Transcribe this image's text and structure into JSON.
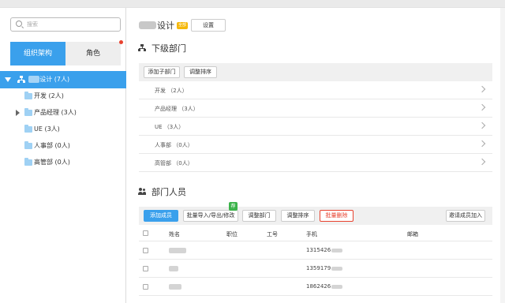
{
  "sidebar": {
    "search_placeholder": "搜索",
    "tabs": [
      {
        "label": "组织架构",
        "active": true
      },
      {
        "label": "角色",
        "active": false
      }
    ],
    "root": {
      "name_suffix": "设计 (7人)"
    },
    "items": [
      {
        "label": "开发 (2人)",
        "has_children": false
      },
      {
        "label": "产品经理 (3人)",
        "has_children": true
      },
      {
        "label": "UE (3人)",
        "has_children": false
      },
      {
        "label": "人事部 (0人)",
        "has_children": false
      },
      {
        "label": "高管部 (0人)",
        "has_children": false
      }
    ]
  },
  "main": {
    "title": "设计",
    "badge": "全部",
    "settings_label": "设置",
    "sub_departments": {
      "heading": "下级部门",
      "buttons": {
        "add": "添加子部门",
        "sort": "调整排序"
      },
      "rows": [
        {
          "label": "开发 （2人）"
        },
        {
          "label": "产品经理 （3人）"
        },
        {
          "label": "UE （3人）"
        },
        {
          "label": "人事部 （0人）"
        },
        {
          "label": "高管部 （0人）"
        }
      ]
    },
    "members": {
      "heading": "部门人员",
      "buttons": {
        "add": "添加成员",
        "batch": "批量导入/导出/修改",
        "batch_badge": "荐",
        "adjust_dept": "调整部门",
        "adjust_sort": "调整排序",
        "batch_delete": "批量删除",
        "invite": "邀请成员加入"
      },
      "columns": [
        "姓名",
        "职位",
        "工号",
        "手机",
        "邮箱"
      ],
      "rows": [
        {
          "phone": "1315426"
        },
        {
          "phone": "1359179"
        },
        {
          "phone": "1862426"
        }
      ]
    }
  },
  "colors": {
    "accent": "#3aa0ec",
    "danger": "#e8422f",
    "badge": "#f5b80a",
    "green": "#3bb34a"
  }
}
